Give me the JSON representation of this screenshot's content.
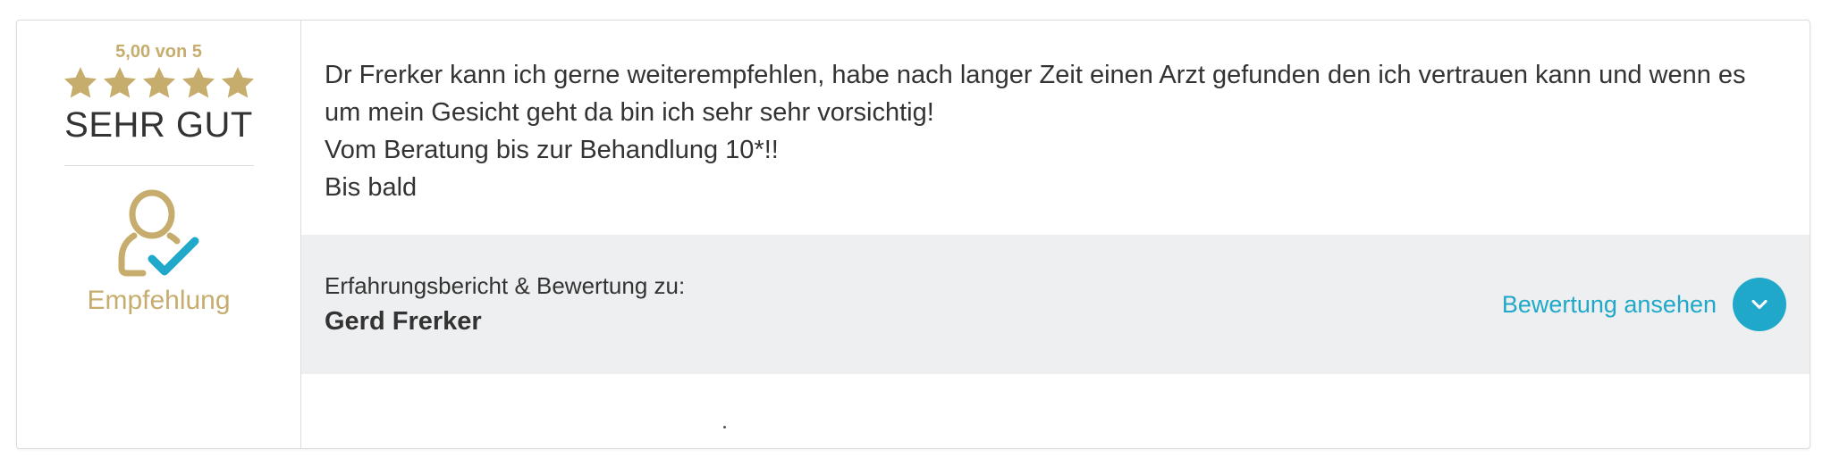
{
  "rating": {
    "score_text": "5,00 von 5",
    "stars": 5,
    "verdict": "SEHR GUT",
    "star_color": "#c6ad6e"
  },
  "recommendation": {
    "icon": "user-check-icon",
    "label": "Empfehlung",
    "accent": "#c6ad6e",
    "check_color": "#1fa8c9"
  },
  "review": {
    "lines": [
      "Dr Frerker kann ich gerne weiterempfehlen, habe nach langer Zeit einen Arzt gefunden den ich vertrauen kann und wenn es um mein Gesicht geht da bin ich sehr sehr vorsichtig!",
      "Vom Beratung bis zur Behandlung 10*!!",
      "Bis bald"
    ]
  },
  "subject": {
    "caption": "Erfahrungsbericht & Bewertung zu:",
    "name": "Gerd Frerker"
  },
  "actions": {
    "view_label": "Bewertung ansehen",
    "view_icon": "chevron-down-icon",
    "link_color": "#1fa8c9"
  }
}
